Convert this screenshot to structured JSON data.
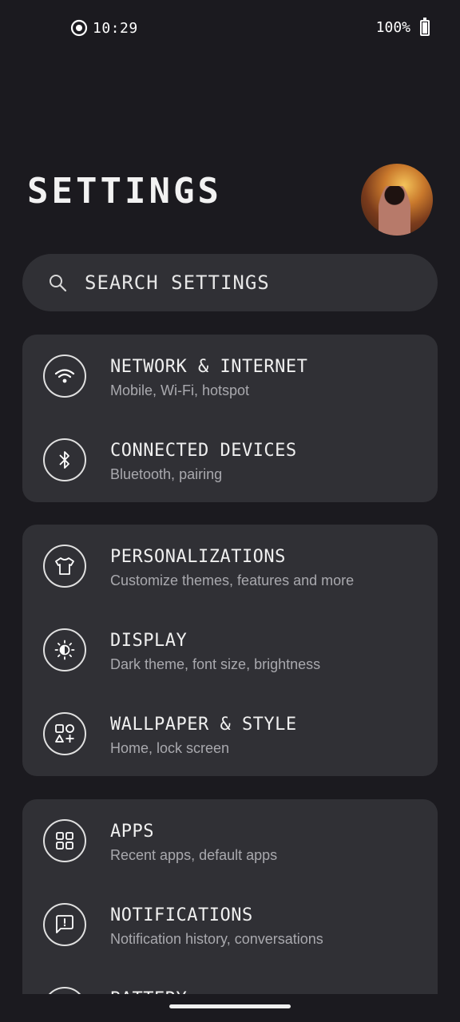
{
  "status_bar": {
    "time": "10:29",
    "battery_text": "100%",
    "record_icon": "record-icon",
    "battery_icon": "battery-icon"
  },
  "header": {
    "title": "SETTINGS",
    "avatar_icon": "avatar"
  },
  "search": {
    "placeholder": "SEARCH SETTINGS",
    "icon": "search-icon"
  },
  "groups": [
    {
      "items": [
        {
          "title": "NETWORK & INTERNET",
          "subtitle": "Mobile, Wi-Fi, hotspot",
          "icon": "wifi-icon"
        },
        {
          "title": "CONNECTED DEVICES",
          "subtitle": "Bluetooth, pairing",
          "icon": "bluetooth-icon"
        }
      ]
    },
    {
      "items": [
        {
          "title": "PERSONALIZATIONS",
          "subtitle": "Customize themes, features and more",
          "icon": "tshirt-icon"
        },
        {
          "title": "DISPLAY",
          "subtitle": "Dark theme, font size, brightness",
          "icon": "brightness-icon"
        },
        {
          "title": "WALLPAPER & STYLE",
          "subtitle": "Home, lock screen",
          "icon": "shapes-icon"
        }
      ]
    },
    {
      "items": [
        {
          "title": "APPS",
          "subtitle": "Recent apps, default apps",
          "icon": "apps-grid-icon"
        },
        {
          "title": "NOTIFICATIONS",
          "subtitle": "Notification history, conversations",
          "icon": "notification-icon"
        },
        {
          "title": "BATTERY",
          "subtitle": "",
          "icon": "battery-setting-icon"
        }
      ]
    }
  ],
  "colors": {
    "background": "#1b1a1f",
    "card": "#303035",
    "subtitle": "#a9a9ae"
  }
}
